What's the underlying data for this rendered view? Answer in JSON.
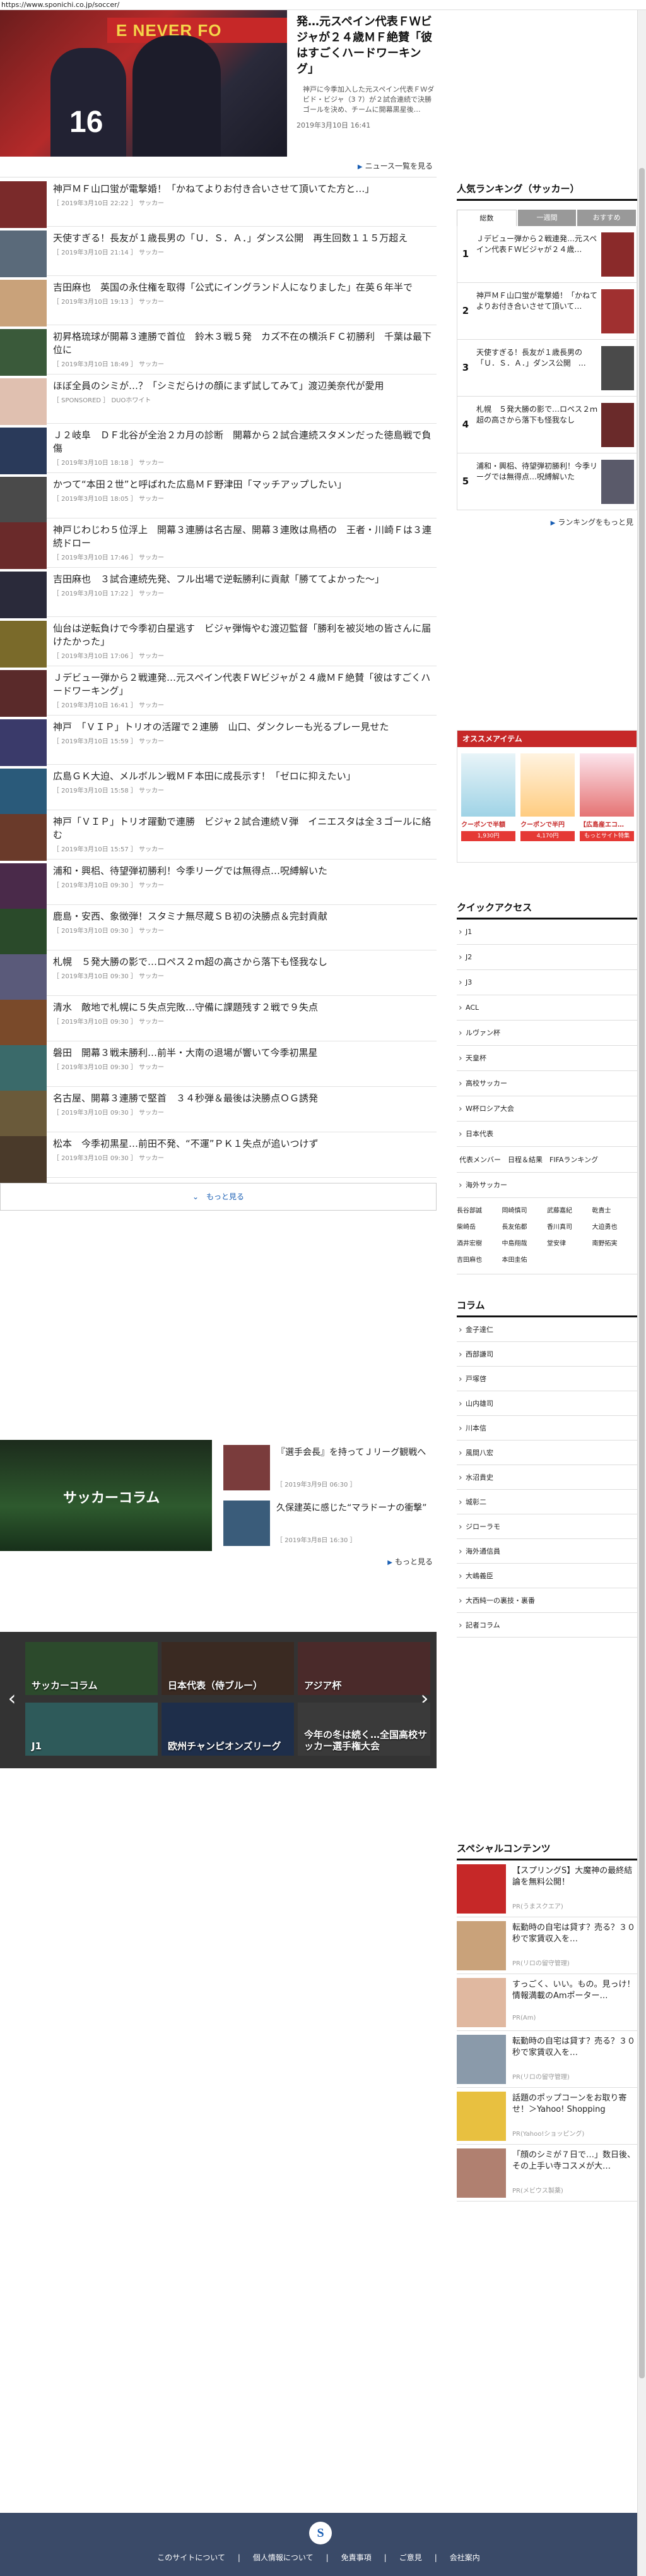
{
  "url": "https://www.sponichi.co.jp/soccer/",
  "hero": {
    "banner": "E NEVER FO",
    "number": "16",
    "title": "発…元スペイン代表ＦＷビジャが２４歳ＭＦ絶賛「彼はすごくハードワーキング」",
    "desc": "神戸に今季加入した元スペイン代表ＦＷダビド・ビジャ（3 7）が２試合連続で決勝ゴールを決め、チームに開幕黒星後…",
    "date": "2019年3月10日 16:41"
  },
  "news_more": "ニュース一覧を見る",
  "news": [
    {
      "title": "神戸ＭＦ山口蛍が電撃婚！「かねてよりお付き合いさせて頂いてた方と…」",
      "meta": "［ 2019年3月10日 22:22 ］ サッカー"
    },
    {
      "title": "天使すぎる！長友が１歳長男の「Ｕ．Ｓ．Ａ．」ダンス公開　再生回数１１５万超え",
      "meta": "［ 2019年3月10日 21:14 ］ サッカー"
    },
    {
      "title": "吉田麻也　英国の永住権を取得「公式にイングランド人になりました」在英６年半で",
      "meta": "［ 2019年3月10日 19:13 ］ サッカー"
    },
    {
      "title": "初昇格琉球が開幕３連勝で首位　鈴木３戦５発　カズ不在の横浜ＦＣ初勝利　千葉は最下位に",
      "meta": "［ 2019年3月10日 18:49 ］ サッカー"
    },
    {
      "title": "ほぼ全員のシミが…？「シミだらけの顔にまず試してみて」渡辺美奈代が愛用",
      "meta": "［ SPONSORED ］ DUOホワイト"
    },
    {
      "title": "Ｊ２岐阜　ＤＦ北谷が全治２カ月の診断　開幕から２試合連続スタメンだった徳島戦で負傷",
      "meta": "［ 2019年3月10日 18:18 ］ サッカー"
    },
    {
      "title": "かつて“本田２世”と呼ばれた広島ＭＦ野津田「マッチアップしたい」",
      "meta": "［ 2019年3月10日 18:05 ］ サッカー"
    },
    {
      "title": "神戸じわじわ５位浮上　開幕３連勝は名古屋、開幕３連敗は鳥栖の　王者・川崎Ｆは３連続ドロー",
      "meta": "［ 2019年3月10日 17:46 ］ サッカー"
    },
    {
      "title": "吉田麻也　３試合連続先発、フル出場で逆転勝利に貢献「勝ててよかった～」",
      "meta": "［ 2019年3月10日 17:22 ］ サッカー"
    },
    {
      "title": "仙台は逆転負けで今季初白星逃す　ビジャ弾悔やむ渡辺監督「勝利を被災地の皆さんに届けたかった」",
      "meta": "［ 2019年3月10日 17:06 ］ サッカー"
    },
    {
      "title": "Ｊデビュー弾から２戦連発…元スペイン代表ＦＷビジャが２４歳ＭＦ絶賛「彼はすごくハードワーキング」",
      "meta": "［ 2019年3月10日 16:41 ］ サッカー"
    },
    {
      "title": "神戸　「ＶＩＰ」トリオの活躍で２連勝　山口、ダンクレーも光るプレー見せた",
      "meta": "［ 2019年3月10日 15:59 ］ サッカー"
    },
    {
      "title": "広島ＧＫ大迫、メルボルン戦ＭＦ本田に成長示す！「ゼロに抑えたい」",
      "meta": "［ 2019年3月10日 15:58 ］ サッカー"
    },
    {
      "title": "神戸「ＶＩＰ」トリオ躍動で連勝　ビジャ２試合連続Ｖ弾　イニエスタは全３ゴールに絡む",
      "meta": "［ 2019年3月10日 15:57 ］ サッカー"
    },
    {
      "title": "浦和・興梠、待望弾初勝利！今季リーグでは無得点…呪縛解いた",
      "meta": "［ 2019年3月10日 09:30 ］ サッカー"
    },
    {
      "title": "鹿島・安西、象徴弾！スタミナ無尽蔵ＳＢ初の決勝点＆完封貢献",
      "meta": "［ 2019年3月10日 09:30 ］ サッカー"
    },
    {
      "title": "札幌　５発大勝の影で…ロペス２ｍ超の高さから落下も怪我なし",
      "meta": "［ 2019年3月10日 09:30 ］ サッカー"
    },
    {
      "title": "清水　敵地で札幌に５失点完敗…守備に課題残す２戦で９失点",
      "meta": "［ 2019年3月10日 09:30 ］ サッカー"
    },
    {
      "title": "磐田　開幕３戦未勝利…前半・大南の退場が響いて今季初黒星",
      "meta": "［ 2019年3月10日 09:30 ］ サッカー"
    },
    {
      "title": "名古屋、開幕３連勝で堅首　３４秒弾＆最後は決勝点ＯＧ誘発",
      "meta": "［ 2019年3月10日 09:30 ］ サッカー"
    },
    {
      "title": "松本　今季初黒星…前田不発、“不運”ＰＫ１失点が追いつけず",
      "meta": "［ 2019年3月10日 09:30 ］ サッカー"
    }
  ],
  "show_more": "もっと見る",
  "column": {
    "feature_label": "サッカーコラム",
    "items": [
      {
        "title": "『選手会長』を持ってＪリーグ観戦へ",
        "date": "［ 2019年3月9日 06:30 ］"
      },
      {
        "title": "久保建英に感じた“マラドーナの衝撃”",
        "date": "［ 2019年3月8日 16:30 ］"
      }
    ],
    "more": "もっと見る"
  },
  "carousel": [
    "サッカーコラム",
    "日本代表（侍ブルー）",
    "アジア杯",
    "J1",
    "欧州チャンピオンズリーグ",
    "今年の冬は続く…全国高校サッカー選手権大会"
  ],
  "ranking": {
    "heading": "人気ランキング（サッカー）",
    "tabs": [
      "総数",
      "一週間",
      "おすすめ"
    ],
    "items": [
      {
        "num": "1",
        "title": "Ｊデビュー弾から２戦連発…元スペイン代表ＦＷビジャが２４歳…"
      },
      {
        "num": "2",
        "title": "神戸ＭＦ山口蛍が電撃婚！「かねてよりお付き合いさせて頂いて…"
      },
      {
        "num": "3",
        "title": "天使すぎる！長友が１歳長男の「Ｕ．Ｓ．Ａ．」ダンス公開　…"
      },
      {
        "num": "4",
        "title": "札幌　５発大勝の影で…ロペス２ｍ超の高さから落下も怪我なし"
      },
      {
        "num": "5",
        "title": "浦和・興梠、待望弾初勝利！今季リーグでは無得点…呪縛解いた"
      }
    ],
    "more": "ランキングをもっと見"
  },
  "ad": {
    "heading": "オススメアイテム",
    "products": [
      {
        "price": "クーポンで半額",
        "button": "1,930円"
      },
      {
        "price": "クーポンで半円",
        "button": "4,170円"
      },
      {
        "price": "【広島産エコ…",
        "button": "もっとサイト特集"
      }
    ]
  },
  "quick_access": {
    "heading": "クイックアクセス",
    "items": [
      "J1",
      "J2",
      "J3",
      "ACL",
      "ルヴァン杯",
      "天皇杯",
      "高校サッカー",
      "W杯ロシア大会",
      "日本代表"
    ],
    "inline": "代表メンバー　日程＆結果　FIFAランキング",
    "items2": [
      "海外サッカー"
    ],
    "grid": [
      "長谷部誠",
      "岡崎慎司",
      "武藤嘉紀",
      "乾貴士",
      "柴崎岳",
      "長友佑都",
      "香川真司",
      "大迫勇也",
      "酒井宏樹",
      "中島翔哉",
      "堂安律",
      "南野拓実",
      "吉田麻也",
      "本田圭佑"
    ]
  },
  "column_list": {
    "heading": "コラム",
    "items": [
      "金子達仁",
      "西部謙司",
      "戸塚啓",
      "山内雄司",
      "川本信",
      "風間八宏",
      "水沼貴史",
      "城彰二",
      "ジローラモ",
      "海外通信員",
      "大嶋義臣",
      "大西純一の裏技・裏番",
      "記者コラム"
    ]
  },
  "special": {
    "heading": "スペシャルコンテンツ",
    "items": [
      {
        "title": "【スプリングS】大魔神の最終結論を無料公開！",
        "pr": "PR(うまスクエア)"
      },
      {
        "title": "転勤時の自宅は貸す？売る？３０秒で家賃収入を…",
        "pr": "PR(リロの留守管理)"
      },
      {
        "title": "すっごく、いい。もの。見っけ！情報満載のAmポーター…",
        "pr": "PR(Am)"
      },
      {
        "title": "転勤時の自宅は貸す？売る？３０秒で家賃収入を…",
        "pr": "PR(リロの留守管理)"
      },
      {
        "title": "話題のポップコーンをお取り寄せ！＞Yahoo! Shopping",
        "pr": "PR(Yahoo!ショッピング)"
      },
      {
        "title": "「顔のシミが７日で…」数日後、その上手い寺コスメが大…",
        "pr": "PR(メビウス製薬)"
      }
    ]
  },
  "footer": {
    "logo": "S",
    "links": [
      "このサイトについて",
      "個人情報について",
      "免責事項",
      "ご意見",
      "会社案内"
    ]
  },
  "colors": {
    "accent": "#1a5fb4",
    "brand_red": "#c62828",
    "footer_bg": "#3a4a68"
  }
}
